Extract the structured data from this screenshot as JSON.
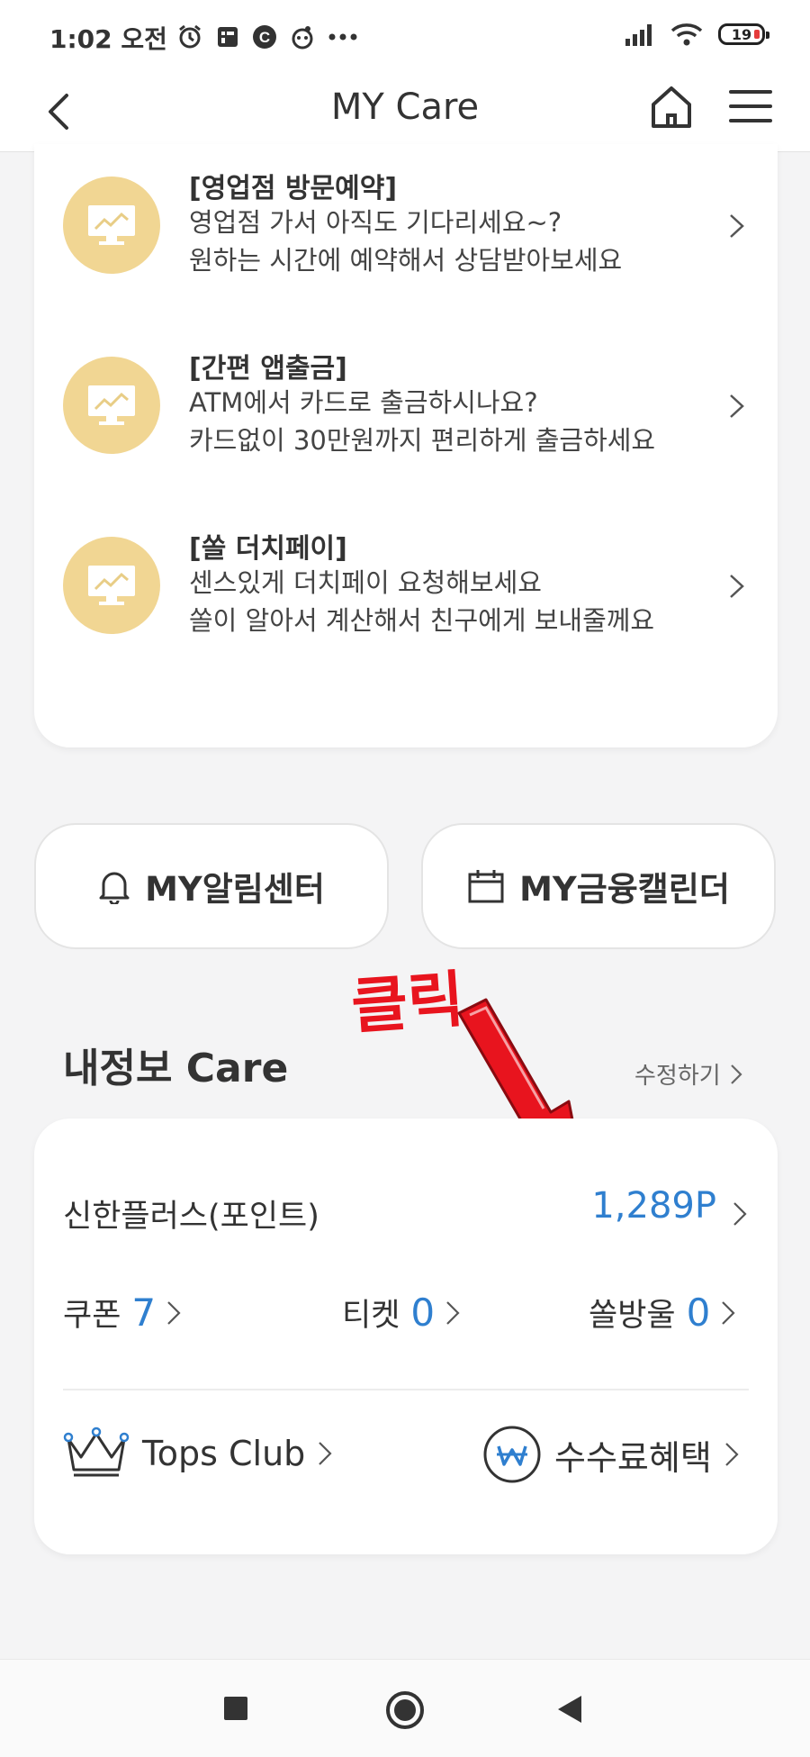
{
  "status": {
    "time": "1:02 오전",
    "battery": "19",
    "icons": [
      "alarm-icon",
      "gallery-icon",
      "c-app-icon",
      "app-icon",
      "more-dots-icon",
      "signal-icon",
      "wifi-icon",
      "battery-icon"
    ]
  },
  "header": {
    "title": "MY Care",
    "icons": [
      "back-arrow-icon",
      "home-icon",
      "hamburger-menu-icon"
    ]
  },
  "services": [
    {
      "title": "[영업점 방문예약]",
      "line1": "영업점 가서 아직도 기다리세요~?",
      "line2": "원하는 시간에 예약해서 상담받아보세요"
    },
    {
      "title": "[간편 앱출금]",
      "line1": "ATM에서 카드로 출금하시나요?",
      "line2": "카드없이 30만원까지 편리하게 출금하세요"
    },
    {
      "title": "[쏠 더치페이]",
      "line1": "센스있게 더치페이 요청해보세요",
      "line2": "쏠이 알아서 계산해서 친구에게 보내줄께요"
    }
  ],
  "quick": {
    "alarm_label": "MY알림센터",
    "calendar_label": "MY금융캘린더"
  },
  "annotation": {
    "text": "클릭",
    "color": "#e8141e"
  },
  "info": {
    "title": "내정보 Care",
    "edit_label": "수정하기",
    "points_label": "신한플러스(포인트)",
    "points_value": "1,289P",
    "coupon_label": "쿠폰",
    "coupon_count": "7",
    "ticket_label": "티켓",
    "ticket_count": "0",
    "drop_label": "쏠방울",
    "drop_count": "0",
    "tops_label": "Tops Club",
    "fee_label": "수수료혜택"
  },
  "colors": {
    "accent_blue": "#2f7fcf",
    "icon_gold": "#f1d693"
  }
}
